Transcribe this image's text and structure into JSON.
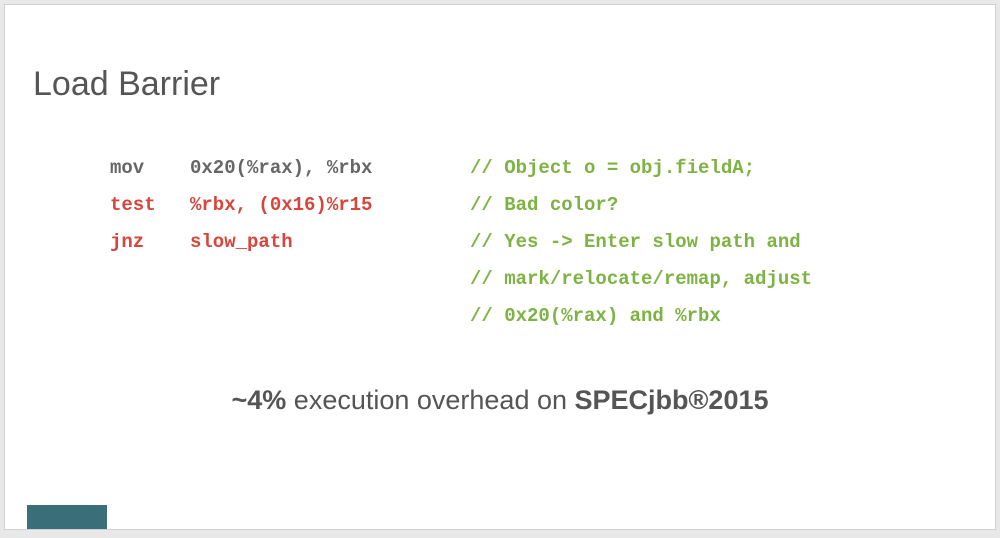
{
  "title": "Load Barrier",
  "code": [
    {
      "mnemonic": "mov",
      "operands": "0x20(%rax), %rbx",
      "comment": "// Object o = obj.fieldA;",
      "red": false
    },
    {
      "mnemonic": "test",
      "operands": "%rbx, (0x16)%r15",
      "comment": "// Bad color?",
      "red": true
    },
    {
      "mnemonic": "jnz",
      "operands": "slow_path",
      "comment": "// Yes -> Enter slow path and",
      "red": true
    },
    {
      "mnemonic": "",
      "operands": "",
      "comment": "// mark/relocate/remap, adjust",
      "red": false
    },
    {
      "mnemonic": "",
      "operands": "",
      "comment": "// 0x20(%rax) and %rbx",
      "red": false
    }
  ],
  "footer": {
    "b1": "~4%",
    "t1": " execution overhead on ",
    "b2": "SPECjbb®2015"
  },
  "badge": ""
}
